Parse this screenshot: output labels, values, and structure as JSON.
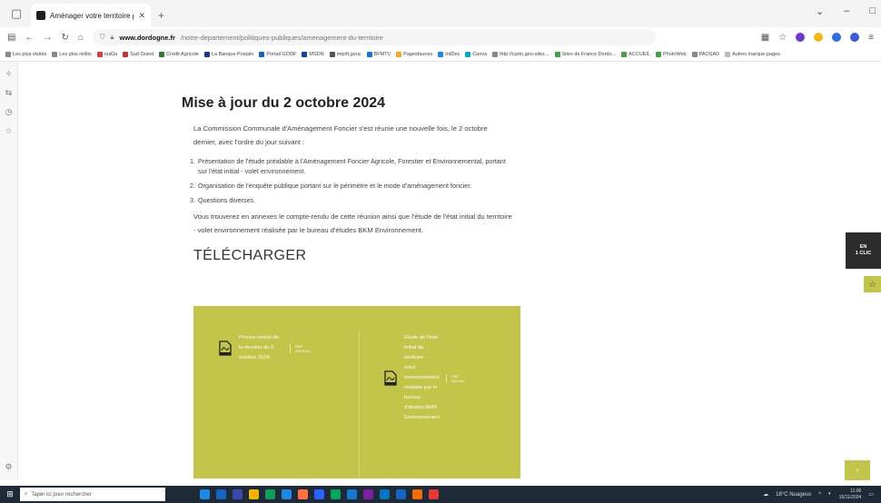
{
  "browser": {
    "tab_title": "Aménager votre territoire pou",
    "url_domain": "www.dordogne.fr",
    "url_rest": "/notre-departement/politiques-publiques/amenagement-du-territoire",
    "bookmarks": [
      "Les plus visités",
      "Les plus redits",
      "ouiDa",
      "Sud Ouest",
      "Crédit Agricole",
      "La Banque Postale",
      "Portail GODF",
      "MSDN",
      "impôt.gouv",
      "BFMTV",
      "Pagesfaunes",
      "IntDes",
      "Canva",
      "http://carto.geo-sitez...",
      "Sites de France Dordo...",
      "ACCUEIL",
      "PhotoWeb",
      "PAOSAD",
      "Autres marque-pages"
    ]
  },
  "article": {
    "title": "Mise à jour du 2 octobre 2024",
    "intro": "La Commission Communale d'Aménagement Foncier s'est réunie une nouvelle fois, le 2 octobre dernier, avec l'ordre du jour suivant :",
    "agenda": [
      {
        "num": "1.",
        "text": "Présentation de l'étude préalable à l'Aménagement Foncier Agricole, Forestier et Environnemental, portant sur l'état initial - volet environnement."
      },
      {
        "num": "2.",
        "text": "Organisation de l'enquête publique portant sur le périmètre et le mode d'aménagement foncier."
      },
      {
        "num": "3.",
        "text": "Questions diverses."
      }
    ],
    "annex": "Vous trouverez en annexes le compte-rendu de cette réunion ainsi que l'étude de l'état initial du territoire - volet environnement réalisée par le bureau d'études BKM Environnement."
  },
  "downloads": {
    "heading": "TÉLÉCHARGER",
    "files": [
      {
        "name": "Procès-verbal de la réunion du 2 octobre 2024",
        "type": "PDF",
        "size": "328.6 Ko"
      },
      {
        "name": "Étude de l'état initial du territoire - volet environnement réalisée par le bureau d'études BKM Environnement",
        "type": "PDF",
        "size": "28.5 Mo"
      }
    ]
  },
  "widgets": {
    "en1clic_line1": "EN",
    "en1clic_line2": "1 CLIC"
  },
  "taskbar": {
    "search_placeholder": "Taper ici pour rechercher",
    "weather": "18°C Nuageux",
    "time": "11:06",
    "date": "16/11/2024"
  },
  "colors": {
    "accent": "#c3c44a",
    "dark": "#2c2c2c",
    "taskbar": "#1f2a38"
  }
}
